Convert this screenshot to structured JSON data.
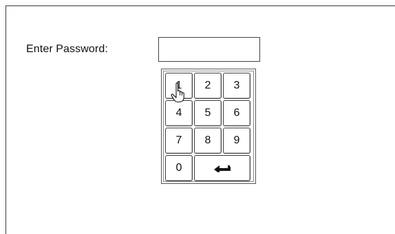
{
  "form": {
    "label": "Enter Password:",
    "password_value": "",
    "password_placeholder": ""
  },
  "keypad": {
    "keys": [
      "1",
      "2",
      "3",
      "4",
      "5",
      "6",
      "7",
      "8",
      "9",
      "0"
    ],
    "enter_icon": "enter-arrow-icon"
  },
  "cursor": {
    "icon": "hand-pointer-icon"
  }
}
